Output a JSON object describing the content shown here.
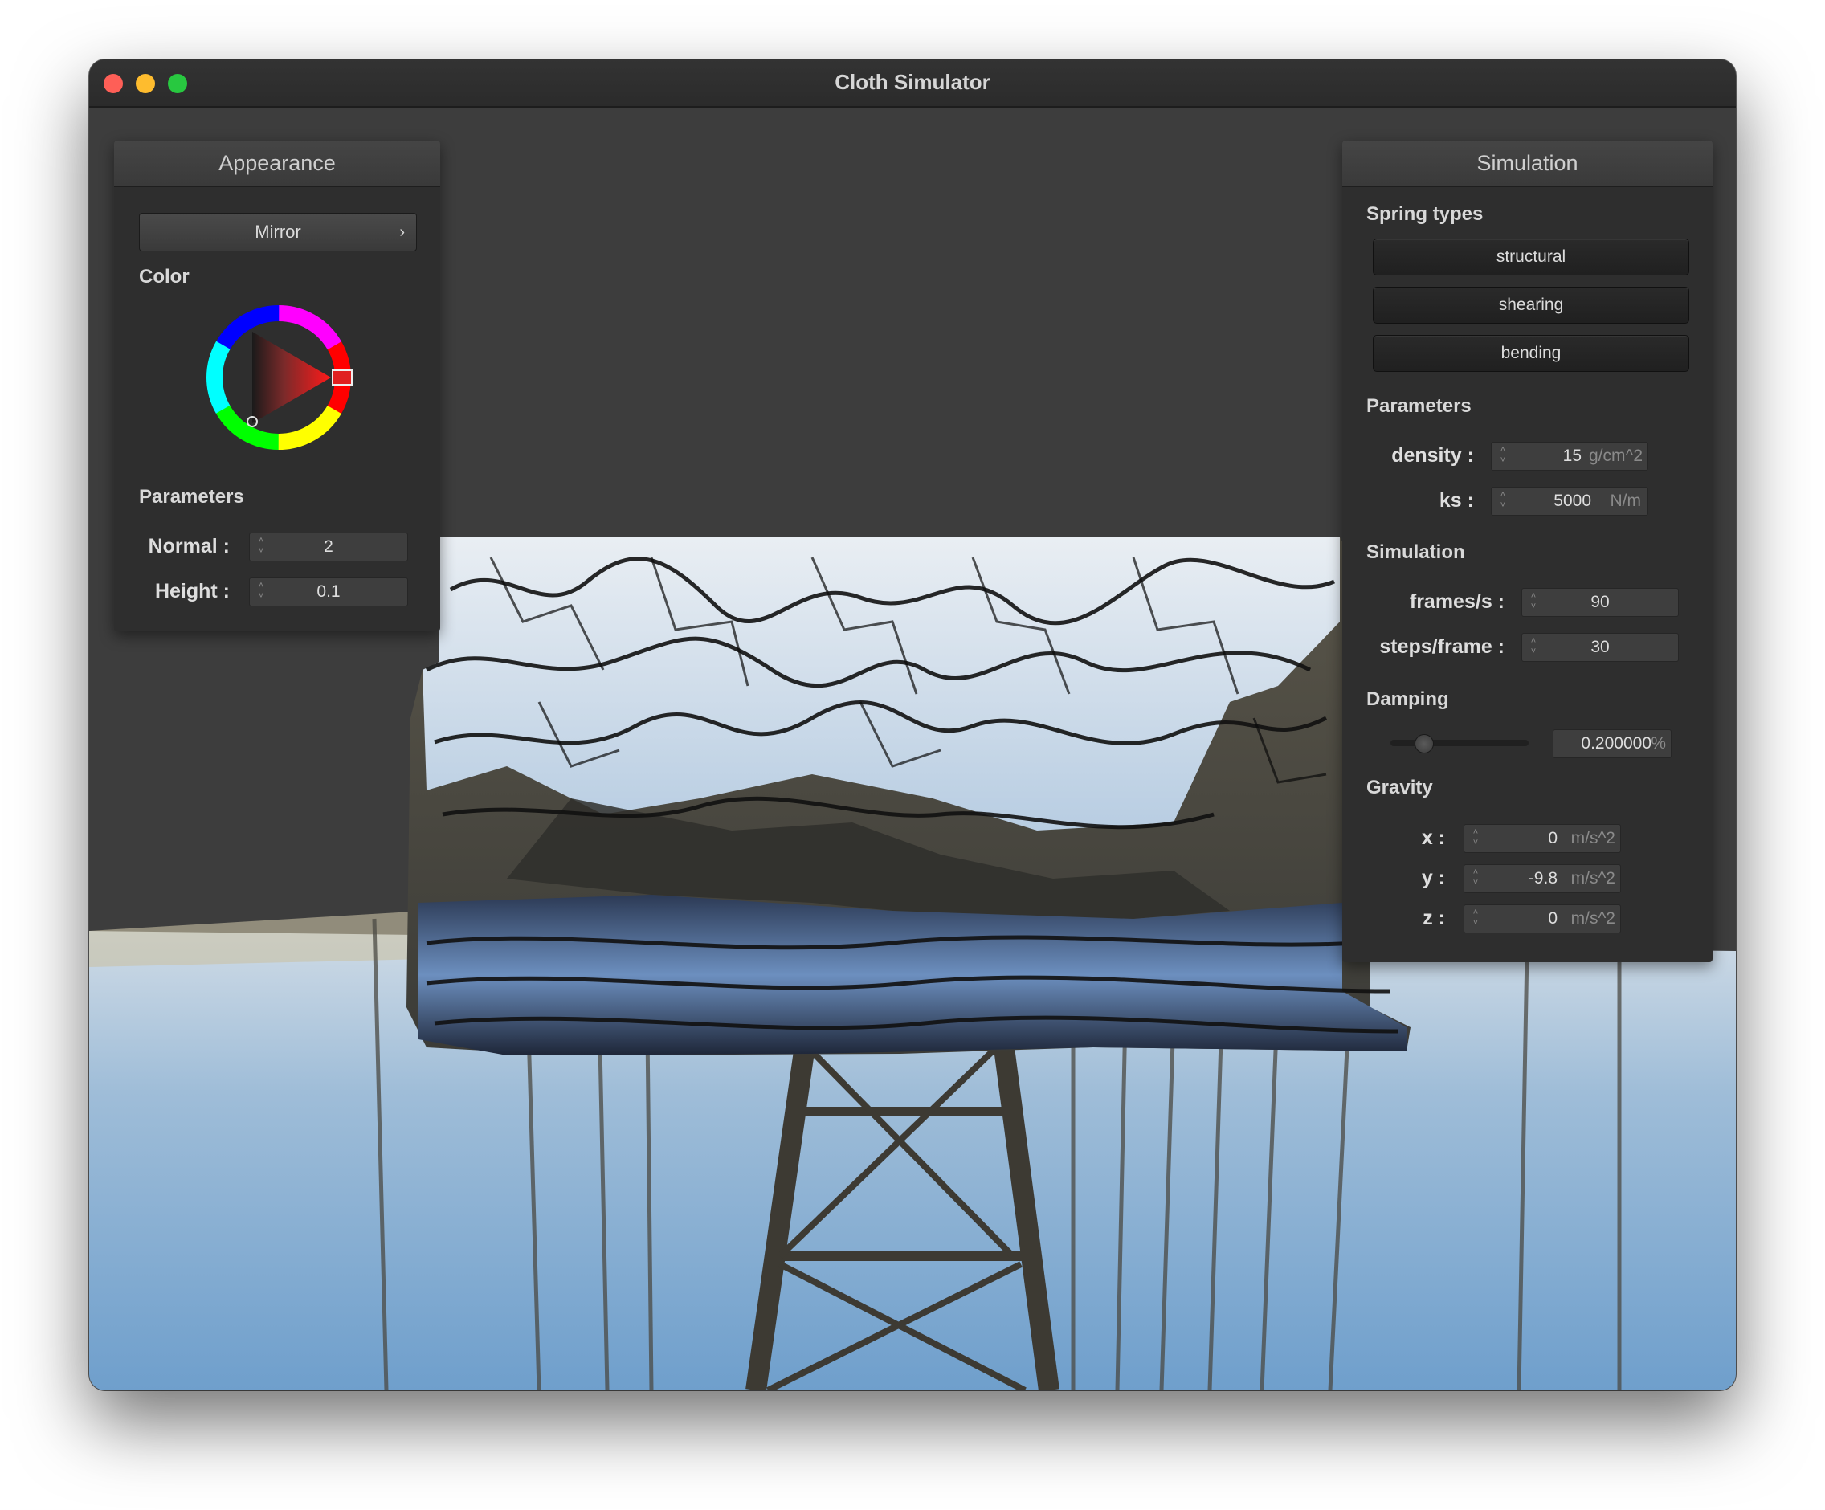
{
  "window": {
    "title": "Cloth Simulator"
  },
  "appearance": {
    "header": "Appearance",
    "shader_button": "Mirror",
    "color_label": "Color",
    "parameters_label": "Parameters",
    "normal_label": "Normal :",
    "normal_value": "2",
    "height_label": "Height :",
    "height_value": "0.1"
  },
  "simulation": {
    "header": "Simulation",
    "spring_types_label": "Spring types",
    "structural_button": "structural",
    "shearing_button": "shearing",
    "bending_button": "bending",
    "parameters_label": "Parameters",
    "density_label": "density :",
    "density_value": "15",
    "density_unit": "g/cm^2",
    "ks_label": "ks :",
    "ks_value": "5000",
    "ks_unit": "N/m",
    "simulation_label": "Simulation",
    "fps_label": "frames/s :",
    "fps_value": "90",
    "steps_label": "steps/frame :",
    "steps_value": "30",
    "damping_label": "Damping",
    "damping_value": "0.200000",
    "damping_unit": "%",
    "damping_fraction": 0.2,
    "gravity_label": "Gravity",
    "gx_label": "x :",
    "gx_value": "0",
    "gy_label": "y :",
    "gy_value": "-9.8",
    "gz_label": "z :",
    "gz_value": "0",
    "g_unit": "m/s^2"
  },
  "icons": {
    "chevron": "chevron-right-icon",
    "spinner": "stepper-arrows-icon"
  },
  "colors": {
    "close": "#fe5f57",
    "minimize": "#febc2e",
    "maximize": "#28c840",
    "selected_color": "#e02020"
  }
}
